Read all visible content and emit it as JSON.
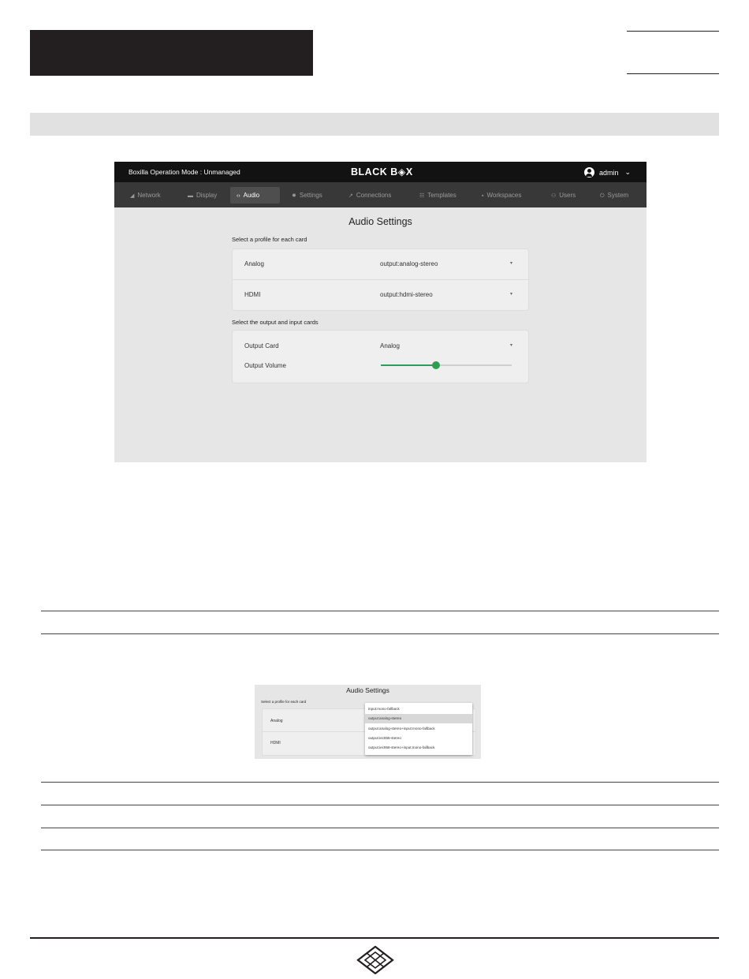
{
  "app": {
    "mode_text": "Boxilla Operation Mode : Unmanaged",
    "brand": "BLACK B◈X",
    "user": "admin",
    "user_caret": "⌄"
  },
  "nav": [
    {
      "icon": "◢",
      "label": "Network"
    },
    {
      "icon": "▬",
      "label": "Display"
    },
    {
      "icon": "‹›",
      "label": "Audio"
    },
    {
      "icon": "✸",
      "label": "Settings"
    },
    {
      "icon": "↗",
      "label": "Connections"
    },
    {
      "icon": "☷",
      "label": "Templates"
    },
    {
      "icon": "▪",
      "label": "Workspaces"
    },
    {
      "icon": "⚇",
      "label": "Users"
    },
    {
      "icon": "⏻",
      "label": "System"
    }
  ],
  "audio": {
    "title": "Audio Settings",
    "profile_label": "Select a profile for each card",
    "profiles": [
      {
        "card": "Analog",
        "value": "output:analog-stereo"
      },
      {
        "card": "HDMI",
        "value": "output:hdmi-stereo"
      }
    ],
    "cards_label": "Select the output and input cards",
    "output_card_label": "Output Card",
    "output_card_value": "Analog",
    "output_volume_label": "Output Volume",
    "output_volume_fraction": 0.42,
    "dropdown_glyph": "▾"
  },
  "audio_dropdown": {
    "title": "Audio Settings",
    "profile_label": "Select a profile for each card",
    "rows": [
      "Analog",
      "HDMI"
    ],
    "options": [
      "input:mono-fallback",
      "output:analog-stereo",
      "output:analog-stereo+input:mono-fallback",
      "output:iec958-stereo",
      "output:iec958-stereo+input:mono-fallback"
    ],
    "selected": "output:analog-stereo"
  },
  "colors": {
    "accent": "#2e9e55",
    "topbar": "#121212",
    "navbar": "#383838"
  }
}
